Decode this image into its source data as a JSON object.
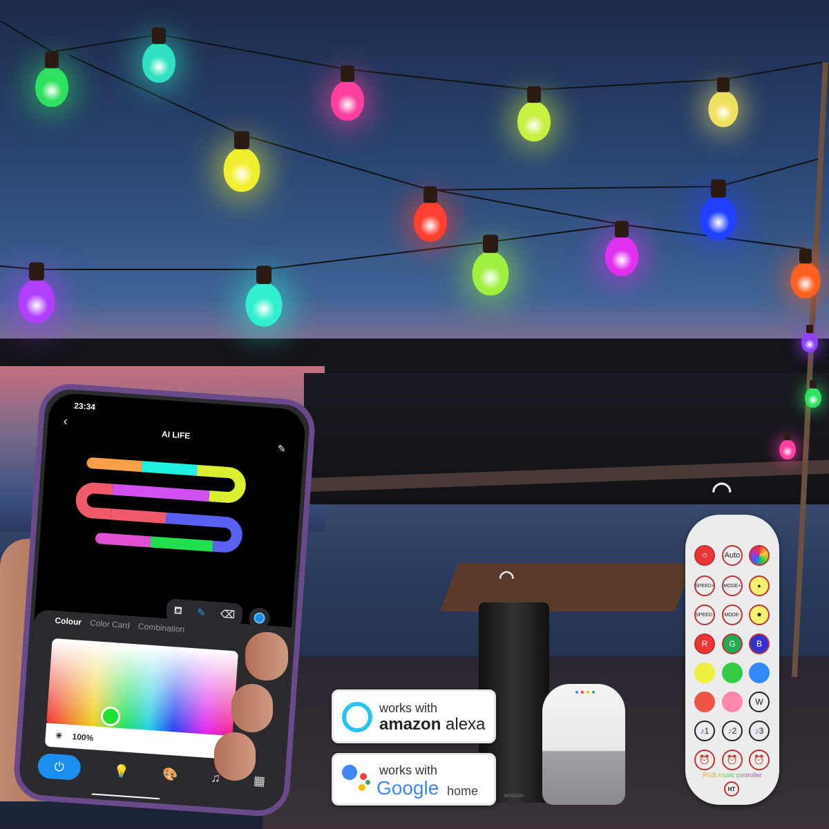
{
  "scene": {
    "bulb_colors": [
      "#30e060",
      "#30e0c0",
      "#ff40a0",
      "#c8f040",
      "#f0e060",
      "#f0f030",
      "#ff4030",
      "#2040ff",
      "#a0f040",
      "#e030f0",
      "#ff6020",
      "#b040ff",
      "#30f0d0",
      "#9040ff",
      "#30e060",
      "#ff40a0"
    ]
  },
  "phone": {
    "time": "23:34",
    "title": "AI LIFE",
    "back_icon": "chevron-left-icon",
    "edit_icon": "pencil-icon",
    "tabs": [
      {
        "label": "Colour",
        "active": true
      },
      {
        "label": "Color Card",
        "active": false
      },
      {
        "label": "Combination",
        "active": false
      }
    ],
    "brightness": "100%",
    "selected_color": "#20e030",
    "tools": [
      "paint-bucket-icon",
      "brush-icon",
      "eraser-icon",
      "color-circle-icon"
    ],
    "nav": [
      "power-icon",
      "bulb-icon",
      "palette-icon",
      "music-icon",
      "grid-icon"
    ]
  },
  "alexa": {
    "line1": "works with",
    "brand": "amazon",
    "product": "alexa"
  },
  "google": {
    "line1": "works with",
    "brand": "Google",
    "product": "home"
  },
  "remote": {
    "buttons": [
      "Auto",
      "SPEED+",
      "MODE+",
      "SPEED-",
      "MODE-",
      "R",
      "G",
      "B",
      "W",
      "1",
      "2",
      "3"
    ],
    "label": "RGB music controller",
    "logo": "HT"
  },
  "echo_label": "amazon"
}
